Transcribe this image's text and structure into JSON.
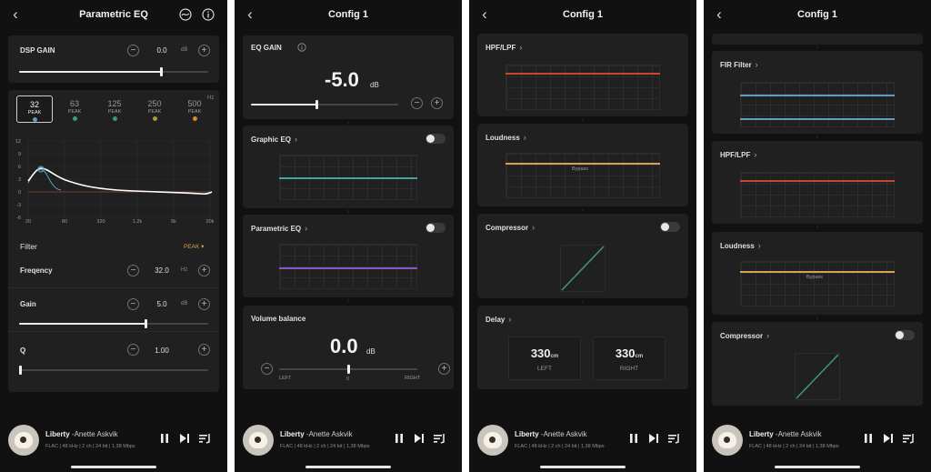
{
  "colors": {
    "teal": "#3fa89a",
    "purple": "#8a55c8",
    "red": "#c9462f",
    "orange": "#d7a052",
    "blue": "#5b9ec0",
    "green": "#3f9a70",
    "eqcurve": "#ffffff"
  },
  "player": {
    "title": "Liberty",
    "artist": "-Anette Askvik",
    "format": "FLAC | 48 kHz | 2 ch | 24 bit | 1,38 Mbps",
    "icons": [
      "pause-icon",
      "next-icon",
      "queue-icon"
    ]
  },
  "screen1": {
    "title": "Parametric EQ",
    "icons": [
      "back-icon",
      "eq-curve-icon",
      "info-icon"
    ],
    "dsp": {
      "label": "DSP GAIN",
      "value": "0.0",
      "unit": "dB",
      "level": 0.75
    },
    "bands": [
      {
        "freq": "32",
        "type": "PEAK",
        "dot": "#5b9ec0"
      },
      {
        "freq": "63",
        "type": "PEAK",
        "dot": "#3f9a70"
      },
      {
        "freq": "125",
        "type": "PEAK",
        "dot": "#3f9a70"
      },
      {
        "freq": "250",
        "type": "PEAK",
        "dot": "#a89a3a"
      },
      {
        "freq": "500",
        "type": "PEAK",
        "dot": "#d7873a"
      }
    ],
    "bands_unit": "Hz",
    "chart": {
      "yticks": [
        "12",
        "9",
        "6",
        "3",
        "0",
        "-3",
        "-6"
      ],
      "xticks": [
        "20",
        "80",
        "320",
        "1.2k",
        "5k",
        "20k"
      ]
    },
    "filter": {
      "label": "Filter",
      "value": "PEAK"
    },
    "frequency": {
      "label": "Freqency",
      "value": "32.0",
      "unit": "Hz"
    },
    "gain": {
      "label": "Gain",
      "value": "5.0",
      "unit": "dB",
      "level": 0.67
    },
    "q": {
      "label": "Q",
      "value": "1.00",
      "level": 0.0
    }
  },
  "screen2": {
    "title": "Config 1",
    "eq_gain": {
      "label": "EQ GAIN",
      "value": "-5.0",
      "unit": "dB",
      "level": 0.45
    },
    "graphic_eq": {
      "label": "Graphic EQ"
    },
    "parametric_eq": {
      "label": "Parametric EQ"
    },
    "volume_balance": {
      "label": "Volume balance",
      "value": "0.0",
      "unit": "dB",
      "left": "LEFT",
      "right": "RIGHT",
      "center": "0",
      "level": 0.5
    }
  },
  "screen3": {
    "title": "Config 1",
    "hpf": {
      "label": "HPF/LPF"
    },
    "loudness": {
      "label": "Loudness",
      "state": "Bypass"
    },
    "compressor": {
      "label": "Compressor"
    },
    "delay": {
      "label": "Delay",
      "left_value": "330",
      "left_unit": "cm",
      "left_label": "LEFT",
      "right_value": "330",
      "right_unit": "cm",
      "right_label": "RIGHT"
    }
  },
  "screen4": {
    "title": "Config 1",
    "fir": {
      "label": "FIR Filter"
    },
    "hpf": {
      "label": "HPF/LPF"
    },
    "loudness": {
      "label": "Loudness",
      "state": "Bypass"
    },
    "compressor": {
      "label": "Compressor"
    }
  }
}
